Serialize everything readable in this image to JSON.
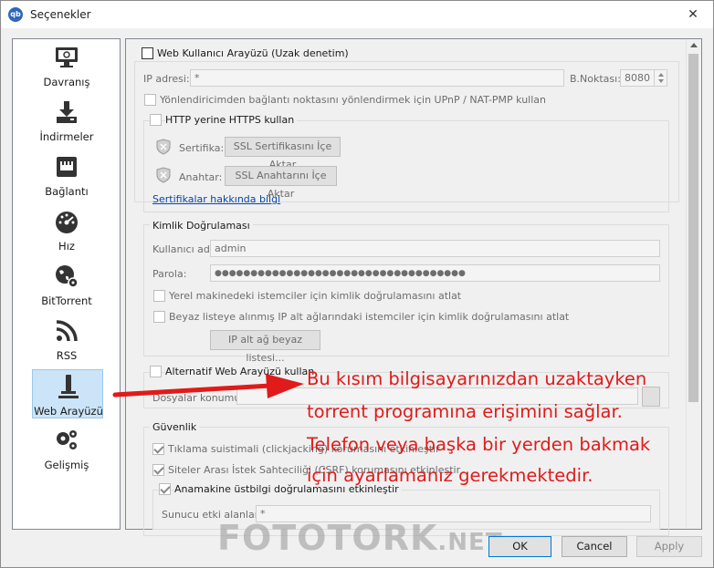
{
  "window": {
    "title": "Seçenekler",
    "app_icon_text": "qb",
    "close_glyph": "✕"
  },
  "sidebar": {
    "items": [
      {
        "label": "Davranış",
        "icon": "monitor-icon"
      },
      {
        "label": "İndirmeler",
        "icon": "download-icon"
      },
      {
        "label": "Bağlantı",
        "icon": "network-icon"
      },
      {
        "label": "Hız",
        "icon": "speedometer-icon"
      },
      {
        "label": "BitTorrent",
        "icon": "globe-icon"
      },
      {
        "label": "RSS",
        "icon": "rss-icon"
      },
      {
        "label": "Web Arayüzü",
        "icon": "webui-icon",
        "active": true
      },
      {
        "label": "Gelişmiş",
        "icon": "gears-icon"
      }
    ]
  },
  "webui": {
    "enable_label": "Web Kullanıcı Arayüzü (Uzak denetim)",
    "ip_label": "IP adresi:",
    "ip_value": "*",
    "port_label": "B.Noktası:",
    "port_value": "8080",
    "upnp_label": "Yönlendiricimden bağlantı noktasını yönlendirmek için UPnP / NAT-PMP kullan",
    "https_label": "HTTP yerine HTTPS kullan",
    "cert_label": "Sertifika:",
    "cert_button": "SSL Sertifikasını İçe Aktar",
    "key_label": "Anahtar:",
    "key_button": "SSL Anahtarını İçe Aktar",
    "cert_link": "Sertifikalar hakkında bilgi"
  },
  "auth": {
    "title": "Kimlik Doğrulaması",
    "username_label": "Kullanıcı adı:",
    "username_value": "admin",
    "password_label": "Parola:",
    "password_value": "●●●●●●●●●●●●●●●●●●●●●●●●●●●●●●●●●●●",
    "localhost_label": "Yerel makinedeki istemciler için kimlik doğrulamasını atlat",
    "whitelist_label": "Beyaz listeye alınmış IP alt ağlarındaki istemciler için kimlik doğrulamasını atlat",
    "whitelist_button": "IP alt ağ beyaz listesi..."
  },
  "alt_webui": {
    "label": "Alternatif Web Arayüzü kullan",
    "files_label": "Dosyalar konumu:"
  },
  "security": {
    "title": "Güvenlik",
    "clickjacking_label": "Tıklama suistimali (clickjacking) korumasını etkinleştir",
    "csrf_label": "Siteler Arası İstek Sahteciliği (CSRF) korumasını etkinleştir",
    "host_header_label": "Anamakine üstbilgi doğrulamasını etkinleştir",
    "server_domains_label": "Sunucu etki alanları:",
    "server_domains_value": "*"
  },
  "footer": {
    "ok": "OK",
    "cancel": "Cancel",
    "apply": "Apply"
  },
  "annotation": {
    "lines": [
      "Bu kısım bilgisayarınızdan uzaktayken",
      "torrent programına erişimini sağlar.",
      "Telefon veya başka bir yerden bakmak",
      "için ayarlamanız gerekmektedir."
    ],
    "color": "#e11a1a"
  },
  "watermark": {
    "main": "FOTOTORK",
    "suffix": ".NET"
  }
}
